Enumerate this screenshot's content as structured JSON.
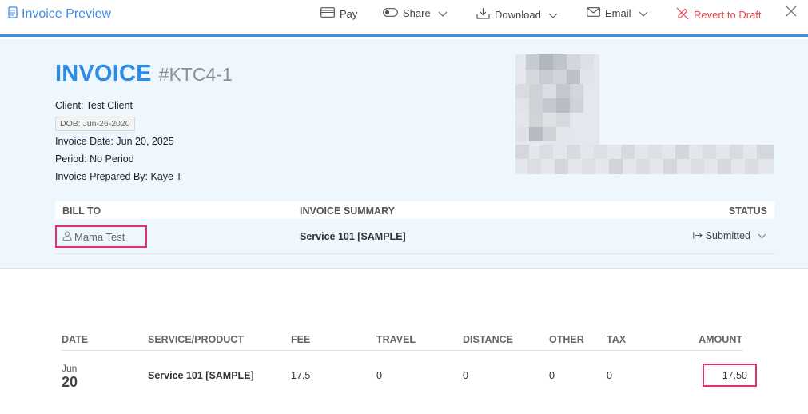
{
  "toolbar": {
    "title": "Invoice Preview",
    "pay": "Pay",
    "share": "Share",
    "download": "Download",
    "email": "Email",
    "revert": "Revert to Draft"
  },
  "invoice": {
    "title": "INVOICE",
    "number": "#KTC4-1",
    "client": "Client: Test Client",
    "dob": "DOB: Jun-26-2020",
    "date": "Invoice Date: Jun 20, 2025",
    "period": "Period: No Period",
    "prepared_by": "Invoice Prepared By: Kaye T"
  },
  "bill_table": {
    "headers": {
      "bill_to": "BILL TO",
      "summary": "INVOICE SUMMARY",
      "status": "STATUS"
    },
    "row": {
      "bill_to": "Mama Test",
      "summary": "Service 101 [SAMPLE]",
      "status": "Submitted"
    }
  },
  "items_table": {
    "headers": {
      "date": "DATE",
      "service": "SERVICE/PRODUCT",
      "fee": "FEE",
      "travel": "TRAVEL",
      "distance": "DISTANCE",
      "other": "OTHER",
      "tax": "TAX",
      "amount": "AMOUNT"
    },
    "rows": [
      {
        "month": "Jun",
        "day": "20",
        "service": "Service 101 [SAMPLE]",
        "fee": "17.5",
        "travel": "0",
        "distance": "0",
        "other": "0",
        "tax": "0",
        "amount": "17.50"
      }
    ]
  },
  "colors": {
    "accent": "#3b8fe6",
    "title_blue": "#2b8de6",
    "header_bg": "#eef6fe",
    "highlight": "#e0306e",
    "revert_red": "#e5484d"
  },
  "icons": {
    "title": "document-icon",
    "pay": "credit-card-icon",
    "share": "toggle-icon",
    "download": "download-icon",
    "email": "envelope-icon",
    "revert": "revert-pencil-icon",
    "close": "close-icon",
    "client": "user-icon",
    "status": "arrow-right-bar-icon"
  }
}
